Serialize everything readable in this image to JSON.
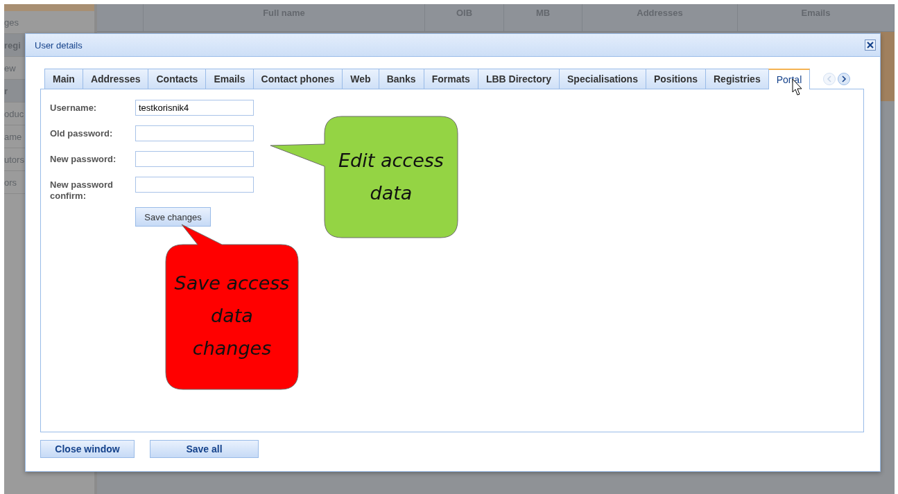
{
  "background": {
    "sidebar_items": [
      {
        "label": "ges",
        "kind": "item"
      },
      {
        "label": "regi",
        "kind": "header"
      },
      {
        "label": "ew",
        "kind": "item"
      },
      {
        "label": "r",
        "kind": "header"
      },
      {
        "label": "oduc",
        "kind": "item"
      },
      {
        "label": "ame",
        "kind": "item"
      },
      {
        "label": "utors",
        "kind": "item"
      },
      {
        "label": "ors",
        "kind": "item"
      }
    ],
    "table_columns": [
      "Full name",
      "OIB",
      "MB",
      "Addresses",
      "Emails"
    ]
  },
  "dialog": {
    "title": "User details",
    "tabs": [
      {
        "label": "Main",
        "selected": false
      },
      {
        "label": "Addresses",
        "selected": false
      },
      {
        "label": "Contacts",
        "selected": false
      },
      {
        "label": "Emails",
        "selected": false
      },
      {
        "label": "Contact phones",
        "selected": false
      },
      {
        "label": "Web",
        "selected": false
      },
      {
        "label": "Banks",
        "selected": false
      },
      {
        "label": "Formats",
        "selected": false
      },
      {
        "label": "LBB Directory",
        "selected": false
      },
      {
        "label": "Specialisations",
        "selected": false
      },
      {
        "label": "Positions",
        "selected": false
      },
      {
        "label": "Registries",
        "selected": false
      },
      {
        "label": "Portal",
        "selected": true
      }
    ],
    "tab_scroll": [
      {
        "disabled": true
      },
      {
        "disabled": false
      }
    ],
    "fields": [
      {
        "label": "Username:",
        "value": "testkorisnik4"
      },
      {
        "label": "Old password:"
      },
      {
        "label": "New password:"
      },
      {
        "label": "New password confirm:"
      }
    ],
    "save_changes_button": "Save changes",
    "buttons": [
      "Close window",
      "Save all"
    ]
  },
  "callouts": [
    {
      "text": "Edit access\ndata",
      "color": "#94d444"
    },
    {
      "text": "Save access\ndata\nchanges",
      "color": "#ff0000"
    }
  ]
}
